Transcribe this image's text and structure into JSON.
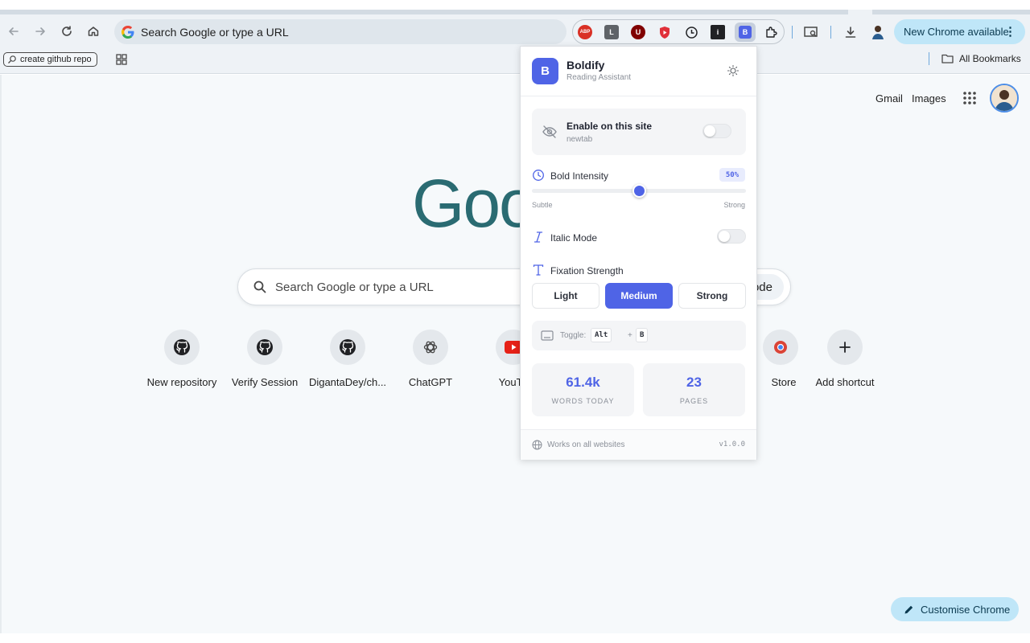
{
  "browser": {
    "omnibox_text": "Search Google or type a URL",
    "new_chrome_label": "New Chrome available",
    "bookmark_chip": "create github repo",
    "all_bookmarks": "All Bookmarks",
    "extensions": [
      "ABP",
      "L",
      "U",
      "",
      "",
      "i",
      "B"
    ]
  },
  "newtab": {
    "gmail": "Gmail",
    "images": "Images",
    "logo": "Goo",
    "search_placeholder": "Search Google or type a URL",
    "ai_mode_fragment": "ode",
    "shortcuts": [
      {
        "label": "New repository"
      },
      {
        "label": "Verify Session"
      },
      {
        "label": "DigantaDey/ch..."
      },
      {
        "label": "ChatGPT"
      },
      {
        "label": "YouTu"
      },
      {
        "label": "Store"
      },
      {
        "label": "Add shortcut"
      }
    ],
    "customise_label": "Customise Chrome"
  },
  "popup": {
    "logo_letter": "B",
    "title": "Boldify",
    "subtitle": "Reading Assistant",
    "enable_title": "Enable on this site",
    "enable_site": "newtab",
    "enable_on": false,
    "intensity_label": "Bold Intensity",
    "intensity_value": "50%",
    "intensity_fraction": 0.5,
    "intensity_min": "Subtle",
    "intensity_max": "Strong",
    "italic_label": "Italic Mode",
    "italic_on": false,
    "fixation_label": "Fixation Strength",
    "fixation_options": [
      "Light",
      "Medium",
      "Strong"
    ],
    "fixation_selected": "Medium",
    "hint_label": "Toggle:",
    "hint_key1": "Alt",
    "hint_plus": "+",
    "hint_key2": "B",
    "stats": [
      {
        "value": "61.4k",
        "caption": "WORDS TODAY"
      },
      {
        "value": "23",
        "caption": "PAGES"
      }
    ],
    "footer_text": "Works on all websites",
    "version": "v1.0.0"
  },
  "colors": {
    "accent": "#4f64e6",
    "chrome_toolbar": "#eef2f6",
    "cta": "#bfe6f8"
  }
}
